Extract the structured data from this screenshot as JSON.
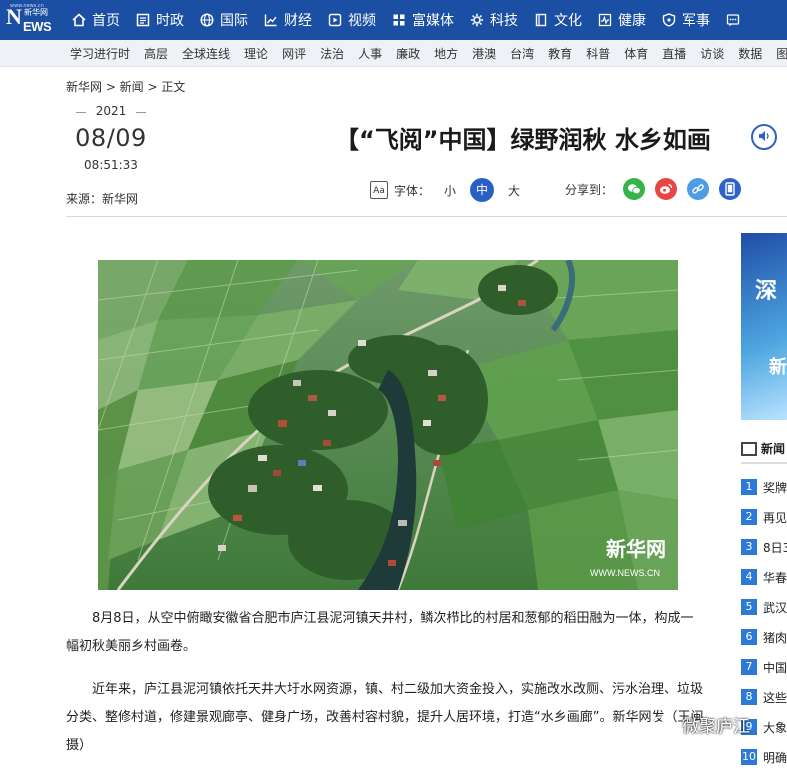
{
  "logo": {
    "main": "N",
    "ews": "EWS",
    "cn": "新华网",
    "url": "www.news.cn"
  },
  "nav": [
    {
      "label": "首页",
      "icon": "home-icon"
    },
    {
      "label": "时政",
      "icon": "newspaper-icon"
    },
    {
      "label": "国际",
      "icon": "globe-icon"
    },
    {
      "label": "财经",
      "icon": "chart-icon"
    },
    {
      "label": "视频",
      "icon": "play-icon"
    },
    {
      "label": "富媒体",
      "icon": "grid-icon"
    },
    {
      "label": "科技",
      "icon": "gear-icon"
    },
    {
      "label": "文化",
      "icon": "book-icon"
    },
    {
      "label": "健康",
      "icon": "pulse-icon"
    },
    {
      "label": "军事",
      "icon": "shield-icon"
    },
    {
      "label": "",
      "icon": "more-icon"
    }
  ],
  "subnav": [
    "学习进行时",
    "高层",
    "全球连线",
    "理论",
    "网评",
    "法治",
    "人事",
    "廉政",
    "地方",
    "港澳",
    "台湾",
    "教育",
    "科普",
    "体育",
    "直播",
    "访谈",
    "数据",
    "图片"
  ],
  "breadcrumb": "新华网 > 新闻 > 正文",
  "date": {
    "year": "2021",
    "monthday": "08/09",
    "time": "08:51:33"
  },
  "source": "来源：新华网",
  "article": {
    "title": "【“飞阅”中国】绿野润秋 水乡如画",
    "p1": "8月8日，从空中俯瞰安徽省合肥市庐江县泥河镇天井村，鳞次栉比的村居和葱郁的稻田融为一体，构成一幅初秋美丽乡村画卷。",
    "p2": "近年来，庐江县泥河镇依托天井大圩水网资源，镇、村二级加大资金投入，实施改水改厕、污水治理、垃圾分类、整修村道，修建景观廊亭、健身广场，改善村容村貌，提升人居环境，打造“水乡画廊”。新华网发（王闽 摄）"
  },
  "fontsize": {
    "label": "字体：",
    "small": "小",
    "medium": "中",
    "large": "大"
  },
  "share": {
    "label": "分享到："
  },
  "photo": {
    "watermark": "新华网",
    "watermark_url": "WWW.NEWS.CN"
  },
  "banner": {
    "line1": "深",
    "line2": "新"
  },
  "rail": {
    "title": "新闻",
    "items": [
      {
        "num": "1",
        "text": "奖牌"
      },
      {
        "num": "2",
        "text": "再见"
      },
      {
        "num": "3",
        "text": "8日3"
      },
      {
        "num": "4",
        "text": "华春"
      },
      {
        "num": "5",
        "text": "武汉"
      },
      {
        "num": "6",
        "text": "猪肉"
      },
      {
        "num": "7",
        "text": "中国"
      },
      {
        "num": "8",
        "text": "这些"
      },
      {
        "num": "9",
        "text": "大象"
      },
      {
        "num": "10",
        "text": "明确"
      }
    ]
  },
  "wechat": "微聚庐江",
  "colors": {
    "nav_bg": "#1b4fa3",
    "accent": "#2860c8",
    "number_badge": "#2d7ad6"
  }
}
